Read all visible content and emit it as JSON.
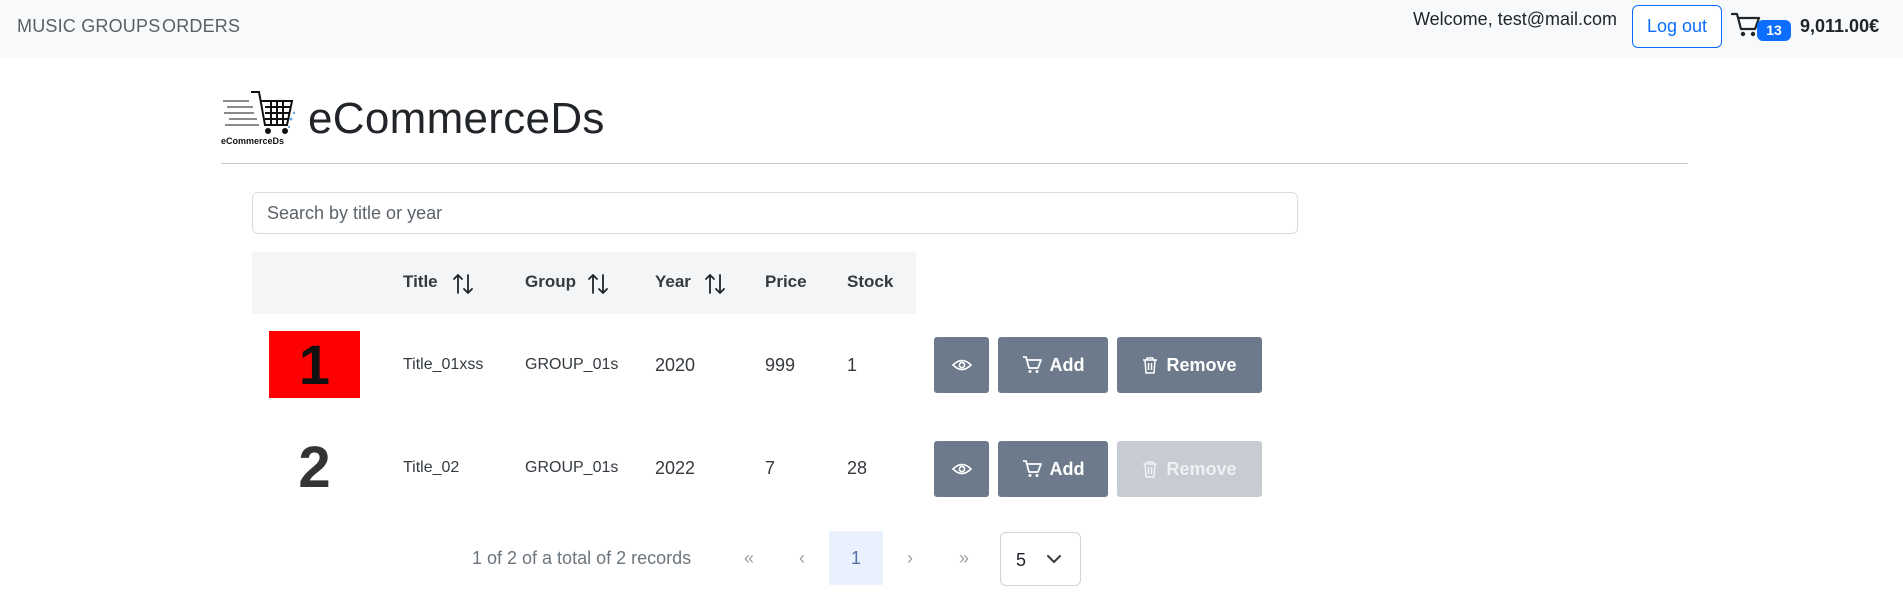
{
  "nav": {
    "links": [
      "MUSIC GROUPS",
      "ORDERS"
    ],
    "welcome": "Welcome, test@mail.com",
    "logout": "Log out",
    "cart_count": "13",
    "cart_total": "9,011.00€",
    "cart_icon": "cart-icon",
    "badge_color": "#0d6efd"
  },
  "brand": {
    "title": "eCommerceDs",
    "logo_text": "eCommerceDs"
  },
  "search": {
    "placeholder": "Search by title or year",
    "value": ""
  },
  "table": {
    "headers": [
      "Title",
      "Group",
      "Year",
      "Price",
      "Stock"
    ],
    "sortable": [
      "Title",
      "Group",
      "Year"
    ],
    "rows": [
      {
        "image_label": "1",
        "title": "Title_01xss",
        "group": "GROUP_01s",
        "year": "2020",
        "price": "999",
        "stock": "1",
        "remove_enabled": true
      },
      {
        "image_label": "2",
        "title": "Title_02",
        "group": "GROUP_01s",
        "year": "2022",
        "price": "7",
        "stock": "28",
        "remove_enabled": false
      }
    ],
    "actions": {
      "view_icon": "eye-icon",
      "add": "Add",
      "remove": "Remove"
    },
    "button_color": "#6c7a8c"
  },
  "pagination": {
    "info": "1 of 2 of a total of 2 records",
    "first": "«",
    "prev": "‹",
    "current": "1",
    "next": "›",
    "last": "»",
    "page_size": "5"
  }
}
